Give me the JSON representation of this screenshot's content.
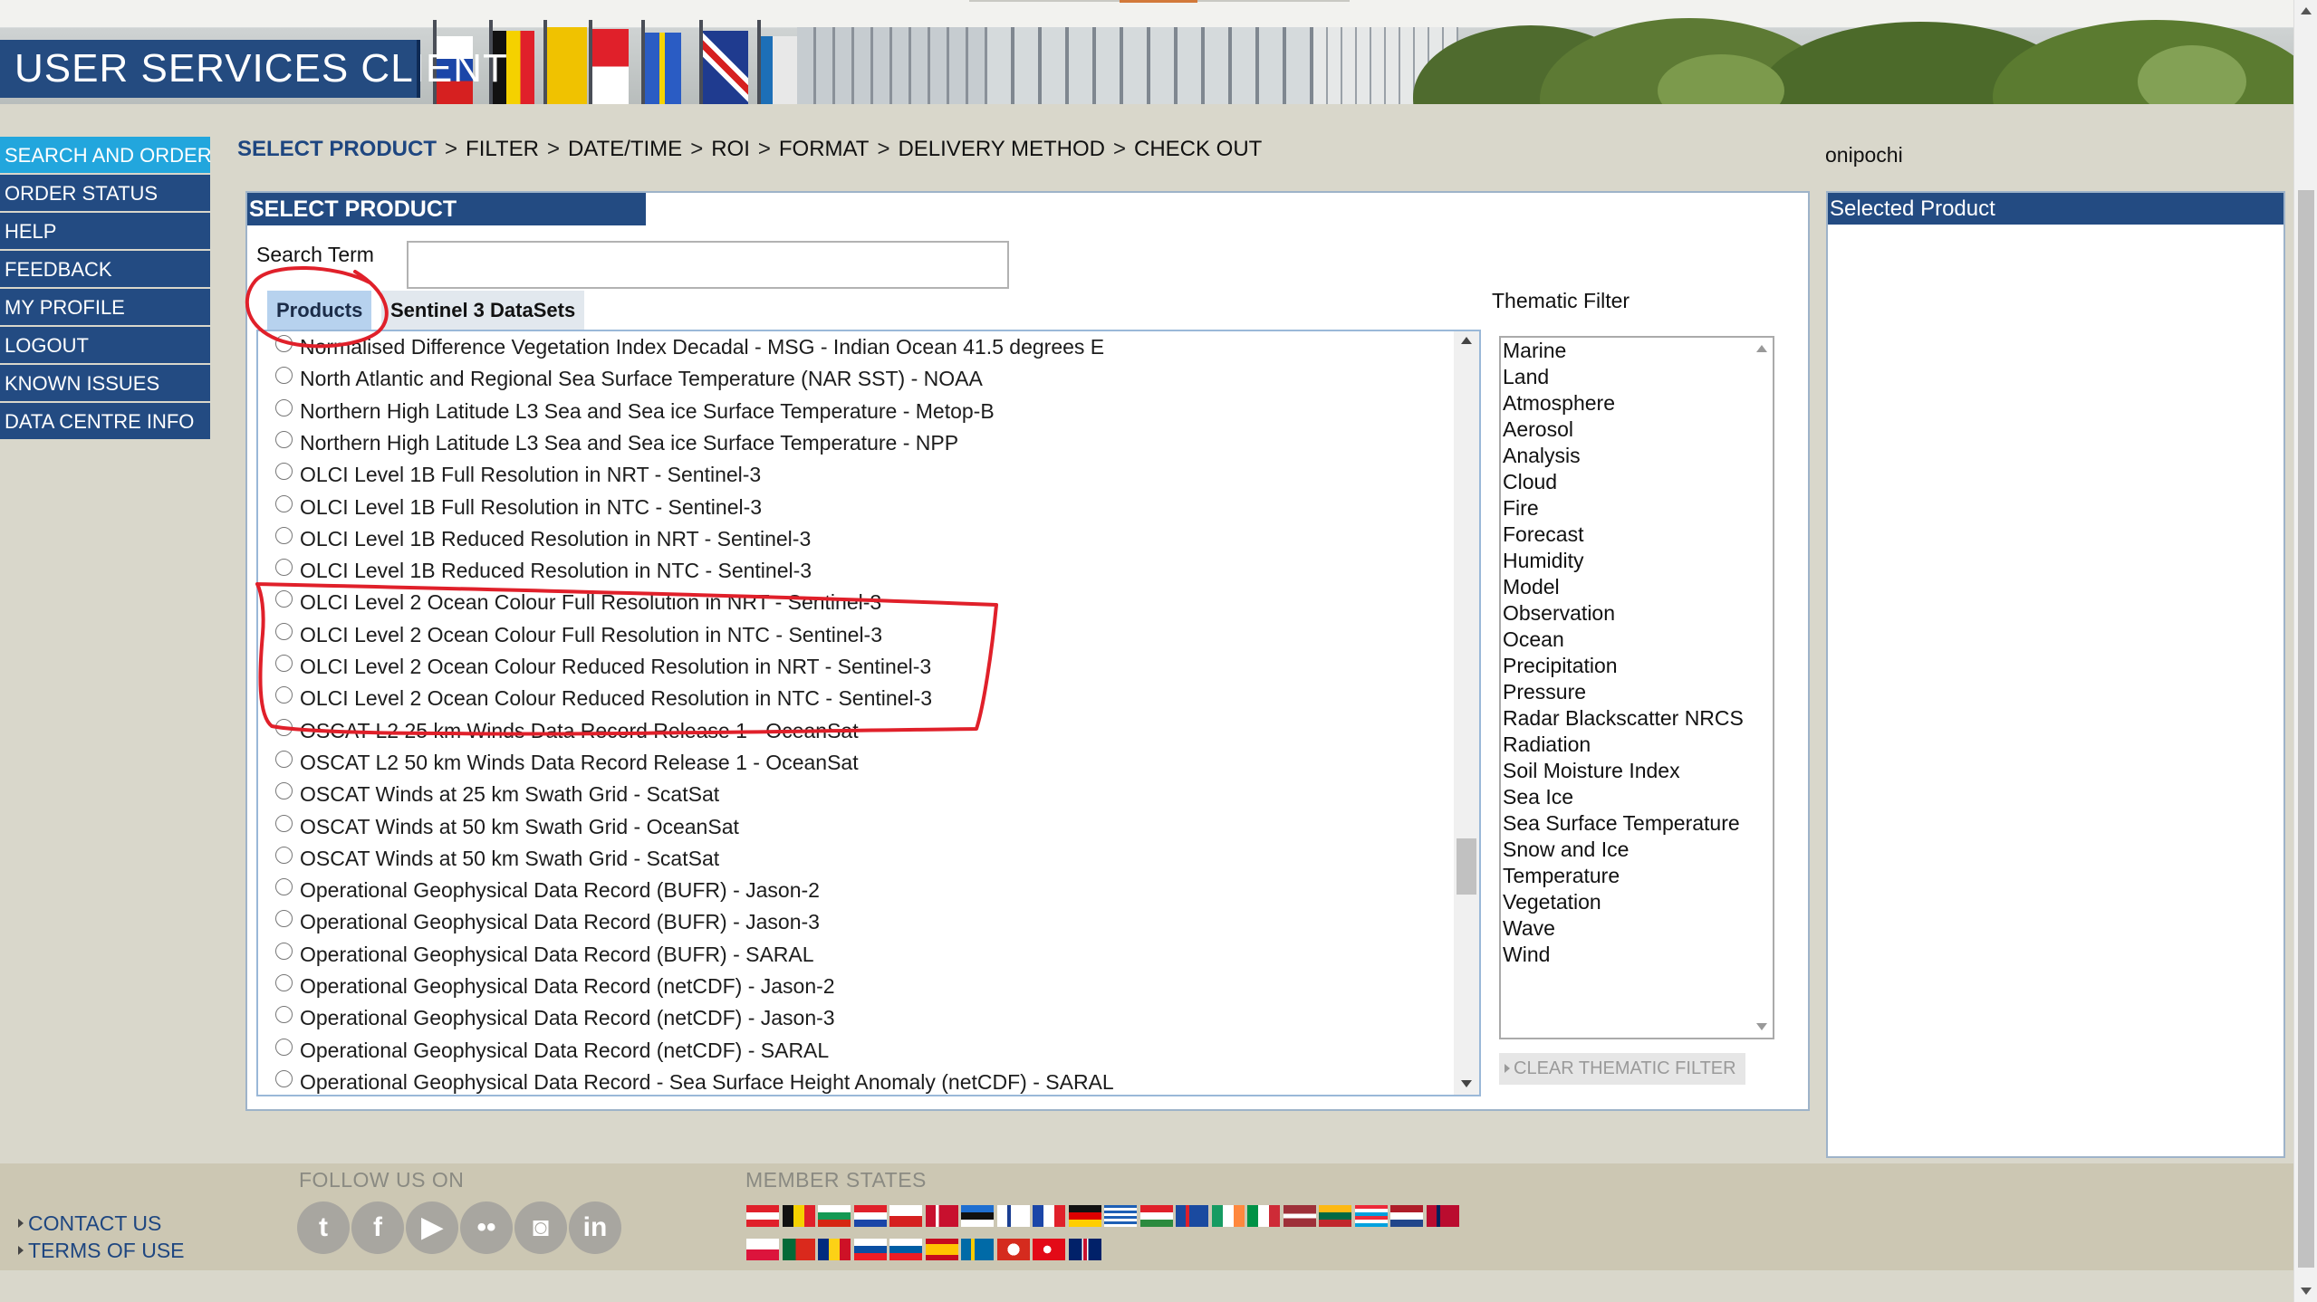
{
  "app": {
    "title": "USER SERVICES CLIENT"
  },
  "nav": {
    "items": [
      {
        "label": "SEARCH AND ORDER",
        "active": true
      },
      {
        "label": "ORDER STATUS"
      },
      {
        "label": "HELP"
      },
      {
        "label": "FEEDBACK"
      },
      {
        "label": "MY PROFILE"
      },
      {
        "label": "LOGOUT"
      },
      {
        "label": "KNOWN ISSUES"
      },
      {
        "label": "DATA CENTRE INFO"
      }
    ]
  },
  "breadcrumb": {
    "steps": [
      "SELECT PRODUCT",
      "FILTER",
      "DATE/TIME",
      "ROI",
      "FORMAT",
      "DELIVERY METHOD",
      "CHECK OUT"
    ],
    "separator": ">"
  },
  "user": {
    "name": "onipochi"
  },
  "select_product": {
    "title": "SELECT PRODUCT",
    "search_label": "Search Term",
    "search_value": "",
    "tabs": [
      {
        "label": "Products",
        "active": true
      },
      {
        "label": "Sentinel 3 DataSets"
      }
    ],
    "products": [
      "Normalised Difference Vegetation Index Decadal - MSG - Indian Ocean 41.5 degrees E",
      "North Atlantic and Regional Sea Surface Temperature (NAR SST) - NOAA",
      "Northern High Latitude L3 Sea and Sea ice Surface Temperature - Metop-B",
      "Northern High Latitude L3 Sea and Sea ice Surface Temperature - NPP",
      "OLCI Level 1B Full Resolution in NRT - Sentinel-3",
      "OLCI Level 1B Full Resolution in NTC - Sentinel-3",
      "OLCI Level 1B Reduced Resolution in NRT - Sentinel-3",
      "OLCI Level 1B Reduced Resolution in NTC - Sentinel-3",
      "OLCI Level 2 Ocean Colour Full Resolution in NRT - Sentinel-3",
      "OLCI Level 2 Ocean Colour Full Resolution in NTC - Sentinel-3",
      "OLCI Level 2 Ocean Colour Reduced Resolution in NRT - Sentinel-3",
      "OLCI Level 2 Ocean Colour Reduced Resolution in NTC - Sentinel-3",
      "OSCAT L2 25 km Winds Data Record Release 1 - OceanSat",
      "OSCAT L2 50 km Winds Data Record Release 1 - OceanSat",
      "OSCAT Winds at 25 km Swath Grid - ScatSat",
      "OSCAT Winds at 50 km Swath Grid - OceanSat",
      "OSCAT Winds at 50 km Swath Grid - ScatSat",
      "Operational Geophysical Data Record (BUFR) - Jason-2",
      "Operational Geophysical Data Record (BUFR) - Jason-3",
      "Operational Geophysical Data Record (BUFR) - SARAL",
      "Operational Geophysical Data Record (netCDF) - Jason-2",
      "Operational Geophysical Data Record (netCDF) - Jason-3",
      "Operational Geophysical Data Record (netCDF) - SARAL",
      "Operational Geophysical Data Record - Sea Surface Height Anomaly (netCDF) - SARAL"
    ],
    "thematic_filter": {
      "label": "Thematic Filter",
      "items": [
        "Marine",
        "Land",
        "Atmosphere",
        "Aerosol",
        "Analysis",
        "Cloud",
        "Fire",
        "Forecast",
        "Humidity",
        "Model",
        "Observation",
        "Ocean",
        "Precipitation",
        "Pressure",
        "Radar Blackscatter NRCS",
        "Radiation",
        "Soil Moisture Index",
        "Sea Ice",
        "Sea Surface Temperature",
        "Snow and Ice",
        "Temperature",
        "Vegetation",
        "Wave",
        "Wind"
      ],
      "clear_label": "CLEAR THEMATIC FILTER"
    }
  },
  "selected_product": {
    "title": "Selected Product"
  },
  "footer": {
    "links": [
      "CONTACT US",
      "TERMS OF USE"
    ],
    "follow_heading": "FOLLOW US ON",
    "social": [
      {
        "name": "twitter-icon",
        "glyph": "t"
      },
      {
        "name": "facebook-icon",
        "glyph": "f"
      },
      {
        "name": "youtube-icon",
        "glyph": "▶"
      },
      {
        "name": "flickr-icon",
        "glyph": "••"
      },
      {
        "name": "instagram-icon",
        "glyph": "◙"
      },
      {
        "name": "linkedin-icon",
        "glyph": "in"
      }
    ],
    "member_heading": "MEMBER STATES"
  },
  "colors": {
    "nav_bg": "#234b82",
    "nav_active": "#22a6dd",
    "annotation": "#e0202a",
    "footer_bg": "#ccc7b3"
  }
}
